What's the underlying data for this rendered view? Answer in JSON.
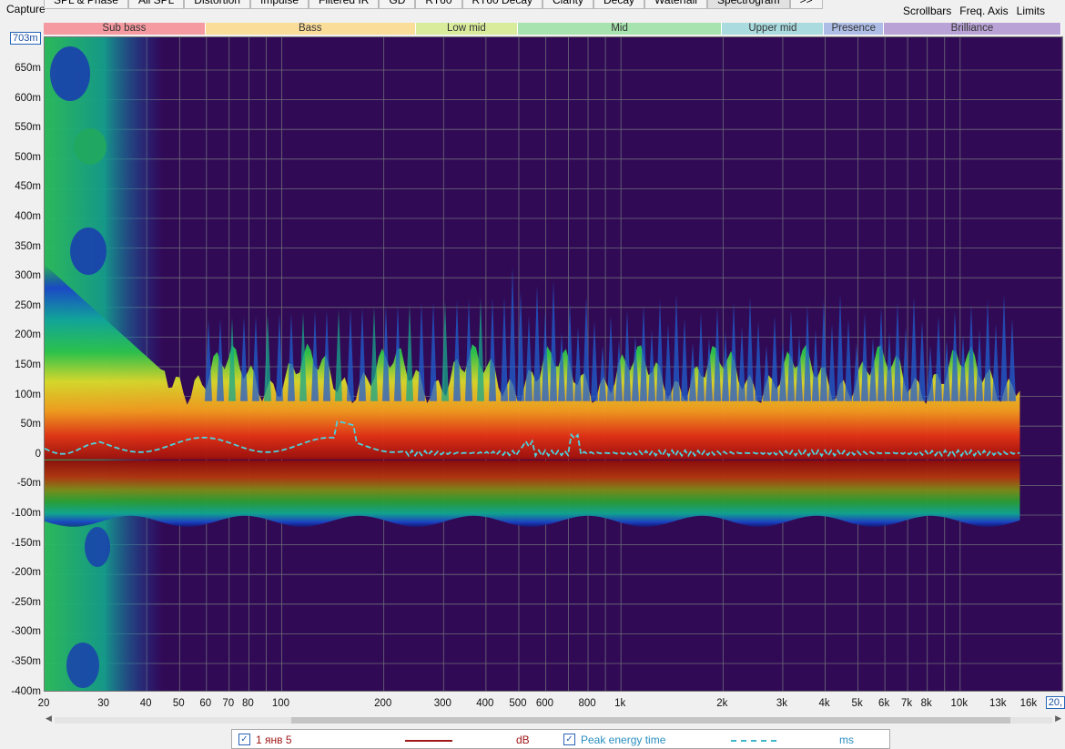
{
  "toolbar": {
    "capture_label": "Capture",
    "tabs": [
      "SPL & Phase",
      "All SPL",
      "Distortion",
      "Impulse",
      "Filtered IR",
      "GD",
      "RT60",
      "RT60 Decay",
      "Clarity",
      "Decay",
      "Waterfall",
      "Spectrogram",
      ">>"
    ],
    "active_tab": "Spectrogram",
    "right_menu": [
      "Scrollbars",
      "Freq. Axis",
      "Limits"
    ]
  },
  "bands": [
    {
      "label": "Sub bass",
      "color": "#f59aa0"
    },
    {
      "label": "Bass",
      "color": "#fbdd9a"
    },
    {
      "label": "Low mid",
      "color": "#d9ec9c"
    },
    {
      "label": "Mid",
      "color": "#a7e3ae"
    },
    {
      "label": "Upper mid",
      "color": "#a9dbdf"
    },
    {
      "label": "Presence",
      "color": "#aebde6"
    },
    {
      "label": "Brilliance",
      "color": "#b9a3d6"
    }
  ],
  "y_axis": {
    "cursor_value": "703m",
    "labels": [
      "650m",
      "600m",
      "550m",
      "500m",
      "450m",
      "400m",
      "350m",
      "300m",
      "250m",
      "200m",
      "150m",
      "100m",
      "50m",
      "0",
      "-50m",
      "-100m",
      "-150m",
      "-200m",
      "-250m",
      "-300m",
      "-350m",
      "-400m"
    ]
  },
  "x_axis": {
    "labels": [
      "20",
      "30",
      "40",
      "50",
      "60",
      "70",
      "80",
      "100",
      "200",
      "300",
      "400",
      "500",
      "600",
      "800",
      "1k",
      "2k",
      "3k",
      "4k",
      "5k",
      "6k",
      "7k",
      "8k",
      "10k",
      "13k",
      "16k"
    ],
    "cursor_value": "20,"
  },
  "legend": {
    "item1_label": "1 янв 5",
    "item1_color": "#a01818",
    "item1_unit": "dB",
    "item2_label": "Peak energy time",
    "item2_color": "#3fb7c9",
    "item2_unit": "ms"
  },
  "colors": {
    "plot_background": "#310a56",
    "peak_line": "#4fd0dd"
  }
}
